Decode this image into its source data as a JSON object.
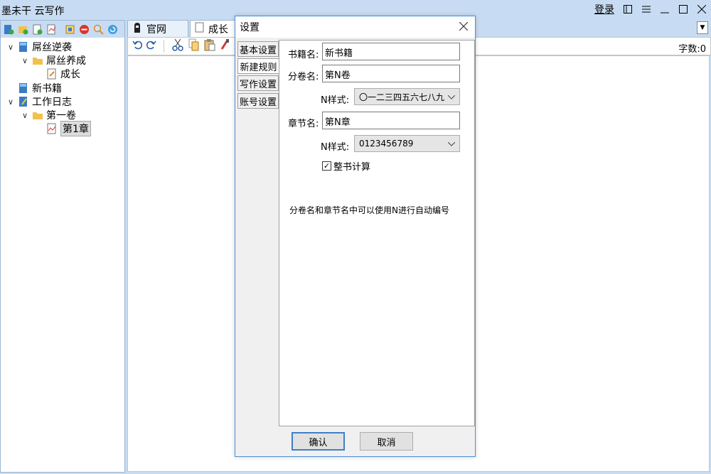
{
  "app": {
    "title": "墨未干 云写作",
    "login": "登录"
  },
  "colors": {
    "accent": "#3c7fc8",
    "chrome": "#c7dcf2"
  },
  "left_toolbar_icons": [
    "new-book-icon",
    "new-volume-icon",
    "new-chapter-icon",
    "import-icon",
    "export-icon",
    "delete-icon",
    "search-icon",
    "refresh-icon"
  ],
  "tree": {
    "book1": "屌丝逆袭",
    "vol1": "屌丝养成",
    "ch1": "成长",
    "book2": "新书籍",
    "book3": "工作日志",
    "vol3": "第一卷",
    "ch3": "第1章"
  },
  "tabs": {
    "home": "官网",
    "doc": "成长"
  },
  "editor": {
    "word_count": "字数:0"
  },
  "dialog": {
    "title": "设置",
    "side_tabs": [
      "基本设置",
      "新建规则",
      "写作设置",
      "账号设置"
    ],
    "book_name_label": "书籍名:",
    "book_name_value": "新书籍",
    "volume_name_label": "分卷名:",
    "volume_name_value": "第N卷",
    "volume_style_label": "N样式:",
    "volume_style_value": "〇一二三四五六七八九",
    "chapter_name_label": "章节名:",
    "chapter_name_value": "第N章",
    "chapter_style_label": "N样式:",
    "chapter_style_value": "0123456789",
    "whole_book_label": "整书计算",
    "whole_book_checked": true,
    "hint": "分卷名和章节名中可以使用N进行自动编号",
    "ok": "确认",
    "cancel": "取消"
  }
}
